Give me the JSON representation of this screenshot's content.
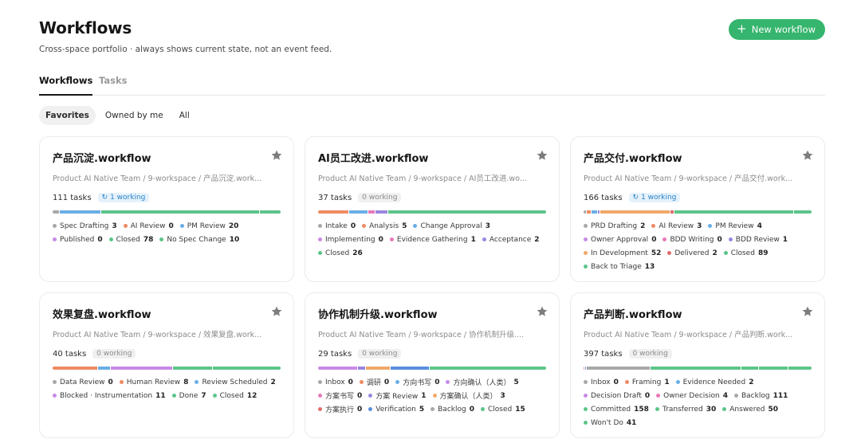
{
  "header": {
    "title": "Workflows",
    "subtitle": "Cross-space portfolio · always shows current state, not an event feed.",
    "new_button": "New workflow"
  },
  "tabs": [
    {
      "label": "Workflows",
      "active": true
    },
    {
      "label": "Tasks",
      "active": false
    }
  ],
  "filters": [
    {
      "label": "Favorites",
      "active": true
    },
    {
      "label": "Owned by me",
      "active": false
    },
    {
      "label": "All",
      "active": false
    }
  ],
  "colors": {
    "accent": "#35b56d",
    "gray": "#a8a8a8",
    "orange": "#ef8a62",
    "blue": "#6aaee6",
    "pink": "#e679b8",
    "green": "#5cc589",
    "purple": "#9a86e0",
    "violet": "#c88ae6",
    "red": "#e06b6b",
    "peach": "#f0a868",
    "steelblue": "#5b8fe0",
    "lime": "#74c98b"
  },
  "cards": [
    {
      "title": "产品沉淀.workflow",
      "path": "Product AI Native Team / 9-workspace / 产品沉淀.work...",
      "tasks": "111 tasks",
      "badge": {
        "text": "1 working",
        "working": true
      },
      "segments": [
        {
          "color": "gray",
          "w": 3
        },
        {
          "color": "blue",
          "w": 20
        },
        {
          "color": "green",
          "w": 78
        },
        {
          "color": "green",
          "w": 10
        }
      ],
      "legend": [
        {
          "label": "Spec Drafting",
          "value": "3",
          "color": "gray"
        },
        {
          "label": "AI Review",
          "value": "0",
          "color": "orange"
        },
        {
          "label": "PM Review",
          "value": "20",
          "color": "blue"
        },
        {
          "label": "Published",
          "value": "0",
          "color": "violet"
        },
        {
          "label": "Closed",
          "value": "78",
          "color": "green"
        },
        {
          "label": "No Spec Change",
          "value": "10",
          "color": "green"
        }
      ]
    },
    {
      "title": "AI员工改进.workflow",
      "path": "Product AI Native Team / 9-workspace / AI员工改进.wo...",
      "tasks": "37 tasks",
      "badge": {
        "text": "0 working",
        "working": false
      },
      "segments": [
        {
          "color": "orange",
          "w": 5
        },
        {
          "color": "blue",
          "w": 3
        },
        {
          "color": "pink",
          "w": 1
        },
        {
          "color": "purple",
          "w": 2
        },
        {
          "color": "green",
          "w": 26
        }
      ],
      "legend": [
        {
          "label": "Intake",
          "value": "0",
          "color": "gray"
        },
        {
          "label": "Analysis",
          "value": "5",
          "color": "orange"
        },
        {
          "label": "Change Approval",
          "value": "3",
          "color": "blue"
        },
        {
          "label": "Implementing",
          "value": "0",
          "color": "violet"
        },
        {
          "label": "Evidence Gathering",
          "value": "1",
          "color": "pink"
        },
        {
          "label": "Acceptance",
          "value": "2",
          "color": "purple"
        },
        {
          "label": "Closed",
          "value": "26",
          "color": "green"
        }
      ]
    },
    {
      "title": "产品交付.workflow",
      "path": "Product AI Native Team / 9-workspace / 产品交付.work...",
      "tasks": "166 tasks",
      "badge": {
        "text": "1 working",
        "working": true
      },
      "segments": [
        {
          "color": "gray",
          "w": 2
        },
        {
          "color": "orange",
          "w": 3
        },
        {
          "color": "blue",
          "w": 4
        },
        {
          "color": "purple",
          "w": 1
        },
        {
          "color": "peach",
          "w": 52
        },
        {
          "color": "red",
          "w": 2
        },
        {
          "color": "green",
          "w": 89
        },
        {
          "color": "green",
          "w": 13
        }
      ],
      "legend": [
        {
          "label": "PRD Drafting",
          "value": "2",
          "color": "gray"
        },
        {
          "label": "AI Review",
          "value": "3",
          "color": "orange"
        },
        {
          "label": "PM Review",
          "value": "4",
          "color": "blue"
        },
        {
          "label": "Owner Approval",
          "value": "0",
          "color": "violet"
        },
        {
          "label": "BDD Writing",
          "value": "0",
          "color": "pink"
        },
        {
          "label": "BDD Review",
          "value": "1",
          "color": "purple"
        },
        {
          "label": "In Development",
          "value": "52",
          "color": "peach"
        },
        {
          "label": "Delivered",
          "value": "2",
          "color": "red"
        },
        {
          "label": "Closed",
          "value": "89",
          "color": "green"
        },
        {
          "label": "Back to Triage",
          "value": "13",
          "color": "green"
        }
      ]
    },
    {
      "title": "效果复盘.workflow",
      "path": "Product AI Native Team / 9-workspace / 效果复盘.work...",
      "tasks": "40 tasks",
      "badge": {
        "text": "0 working",
        "working": false
      },
      "segments": [
        {
          "color": "orange",
          "w": 8
        },
        {
          "color": "blue",
          "w": 2
        },
        {
          "color": "violet",
          "w": 11
        },
        {
          "color": "green",
          "w": 7
        },
        {
          "color": "green",
          "w": 12
        }
      ],
      "legend": [
        {
          "label": "Data Review",
          "value": "0",
          "color": "gray"
        },
        {
          "label": "Human Review",
          "value": "8",
          "color": "orange"
        },
        {
          "label": "Review Scheduled",
          "value": "2",
          "color": "blue"
        },
        {
          "label": "Blocked · Instrumentation",
          "value": "11",
          "color": "violet"
        },
        {
          "label": "Done",
          "value": "7",
          "color": "green"
        },
        {
          "label": "Closed",
          "value": "12",
          "color": "green"
        }
      ]
    },
    {
      "title": "协作机制升级.workflow",
      "path": "Product AI Native Team / 9-workspace / 协作机制升级....",
      "tasks": "29 tasks",
      "badge": {
        "text": "0 working",
        "working": false
      },
      "segments": [
        {
          "color": "violet",
          "w": 5
        },
        {
          "color": "purple",
          "w": 1
        },
        {
          "color": "peach",
          "w": 3
        },
        {
          "color": "steelblue",
          "w": 5
        },
        {
          "color": "green",
          "w": 15
        }
      ],
      "legend": [
        {
          "label": "Inbox",
          "value": "0",
          "color": "gray"
        },
        {
          "label": "调研",
          "value": "0",
          "color": "orange"
        },
        {
          "label": "方向书写",
          "value": "0",
          "color": "blue"
        },
        {
          "label": "方向确认（人类）",
          "value": "5",
          "color": "violet"
        },
        {
          "label": "方案书写",
          "value": "0",
          "color": "pink"
        },
        {
          "label": "方案 Review",
          "value": "1",
          "color": "purple"
        },
        {
          "label": "方案确认（人类）",
          "value": "3",
          "color": "peach"
        },
        {
          "label": "方案执行",
          "value": "0",
          "color": "red"
        },
        {
          "label": "Verification",
          "value": "5",
          "color": "steelblue"
        },
        {
          "label": "Backlog",
          "value": "0",
          "color": "gray"
        },
        {
          "label": "Closed",
          "value": "15",
          "color": "green"
        }
      ]
    },
    {
      "title": "产品判断.workflow",
      "path": "Product AI Native Team / 9-workspace / 产品判断.work...",
      "tasks": "397 tasks",
      "badge": {
        "text": "0 working",
        "working": false
      },
      "segments": [
        {
          "color": "orange",
          "w": 1
        },
        {
          "color": "blue",
          "w": 2
        },
        {
          "color": "gray",
          "w": 111
        },
        {
          "color": "green",
          "w": 158
        },
        {
          "color": "green",
          "w": 30
        },
        {
          "color": "green",
          "w": 50
        },
        {
          "color": "green",
          "w": 41
        }
      ],
      "legend": [
        {
          "label": "Inbox",
          "value": "0",
          "color": "gray"
        },
        {
          "label": "Framing",
          "value": "1",
          "color": "orange"
        },
        {
          "label": "Evidence Needed",
          "value": "2",
          "color": "blue"
        },
        {
          "label": "Decision Draft",
          "value": "0",
          "color": "violet"
        },
        {
          "label": "Owner Decision",
          "value": "4",
          "color": "pink"
        },
        {
          "label": "Backlog",
          "value": "111",
          "color": "gray"
        },
        {
          "label": "Committed",
          "value": "158",
          "color": "green"
        },
        {
          "label": "Transferred",
          "value": "30",
          "color": "green"
        },
        {
          "label": "Answered",
          "value": "50",
          "color": "green"
        },
        {
          "label": "Won't Do",
          "value": "41",
          "color": "green"
        }
      ]
    }
  ]
}
